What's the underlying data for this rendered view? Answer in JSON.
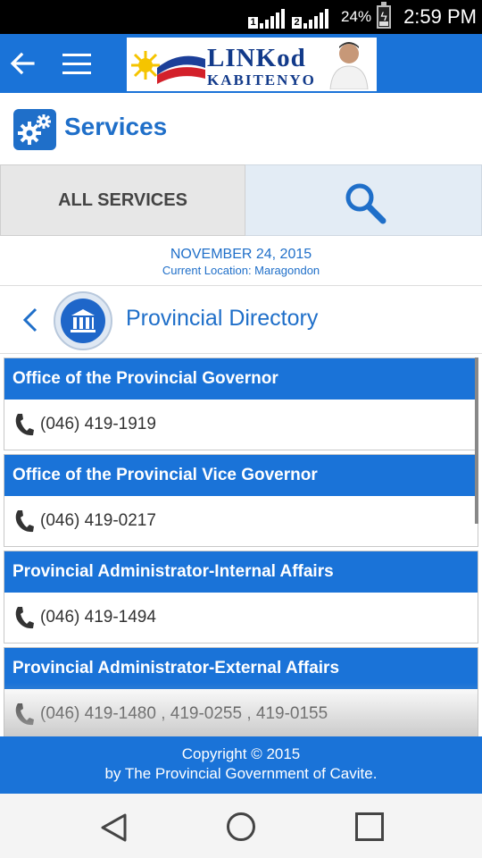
{
  "status_bar": {
    "sim1": "1",
    "sim2": "2",
    "battery_percent": "24%",
    "battery_level": 0.24,
    "time": "2:59 PM"
  },
  "toolbar": {
    "logo_title": "LINKod",
    "logo_subtitle": "KABITENYO",
    "brand_color": "#1a73d8"
  },
  "services": {
    "title": "Services"
  },
  "tabs": {
    "all_services": "ALL SERVICES"
  },
  "date_block": {
    "date": "NOVEMBER 24, 2015",
    "location": "Current Location: Maragondon"
  },
  "directory": {
    "title": "Provincial Directory",
    "entries": [
      {
        "name": "Office of the Provincial Governor",
        "phone": "(046) 419-1919"
      },
      {
        "name": "Office of the Provincial Vice Governor",
        "phone": "(046) 419-0217"
      },
      {
        "name": "Provincial Administrator-Internal Affairs",
        "phone": "(046) 419-1494"
      },
      {
        "name": "Provincial Administrator-External Affairs",
        "phone": "(046) 419-1480 , 419-0255 , 419-0155"
      }
    ]
  },
  "footer": {
    "line1": "Copyright © 2015",
    "line2": "by The Provincial Government of Cavite."
  },
  "icons": [
    "back-arrow-icon",
    "menu-icon",
    "gears-icon",
    "search-icon",
    "chevron-left-icon",
    "building-icon",
    "phone-icon",
    "nav-back-icon",
    "nav-home-icon",
    "nav-recent-icon"
  ]
}
